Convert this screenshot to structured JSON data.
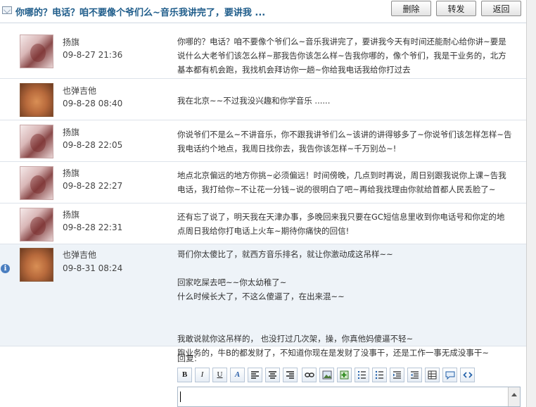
{
  "thread": {
    "title": "你哪的？电话？咱不要像个爷们么~音乐我讲完了，要讲我  ...",
    "buttons": {
      "delete": "删除",
      "forward": "转发",
      "back": "返回"
    }
  },
  "messages": [
    {
      "author": "扬旗",
      "time": "09-8-27 21:36",
      "avatar": "a",
      "body": "你哪的？电话？咱不要像个爷们么~音乐我讲完了，要讲我今天有时间还能耐心给你讲~要是\n说什么大老爷们该怎么样~那我告你该怎么样~告我你哪的，像个爷们，我是干业务的，北方\n基本都有机会跑，我找机会拜访你一趟~你给我电话我给你打过去"
    },
    {
      "author": "也弹吉他",
      "time": "09-8-28 08:40",
      "avatar": "b",
      "body": "我在北京~~不过我没兴趣和你学音乐  ......"
    },
    {
      "author": "扬旗",
      "time": "09-8-28 22:05",
      "avatar": "a",
      "body": "你说爷们不是么~不讲音乐，你不跟我讲爷们么~该讲的讲得够多了~你说爷们该怎样怎样~告\n我电话约个地点，我周日找你去，我告你该怎样~千万别怂~!"
    },
    {
      "author": "扬旗",
      "time": "09-8-28 22:27",
      "avatar": "a",
      "body": "地点北京偏远的地方你挑~必须偏远！时间傍晚，几点到时再说，周日别跟我说你上课~告我\n电话，我打给你~不让花一分钱~说的很明白了吧~再给我找理由你就给首都人民丢脸了~"
    },
    {
      "author": "扬旗",
      "time": "09-8-28 22:31",
      "avatar": "a",
      "body": "还有忘了说了，明天我在天津办事，多晚回来我只要在GC短信息里收到你电话号和你定的地\n点周日我给你打电话上火车~期待你痛快的回信!"
    },
    {
      "author": "也弹吉他",
      "time": "09-8-31 08:24",
      "avatar": "b",
      "body": "哥们你太傻比了，就西方音乐排名，就让你激动成这吊样~~\n\n回家吃屎去吧~~你太幼稚了~\n什么时候长大了，不这么傻逼了，在出来混~~\n\n\n我敢说就你这吊样的，  也没打过几次架，操，你真他妈傻逼不轻~\n跑业务的，牛B的都发财了，不知道你现在是发财了没事干，还是工作一事无成没事干~"
    }
  ],
  "reply": {
    "label": "回复:",
    "toolbar": {
      "bold": "B",
      "italic": "I",
      "underline": "U",
      "font": "A"
    }
  }
}
